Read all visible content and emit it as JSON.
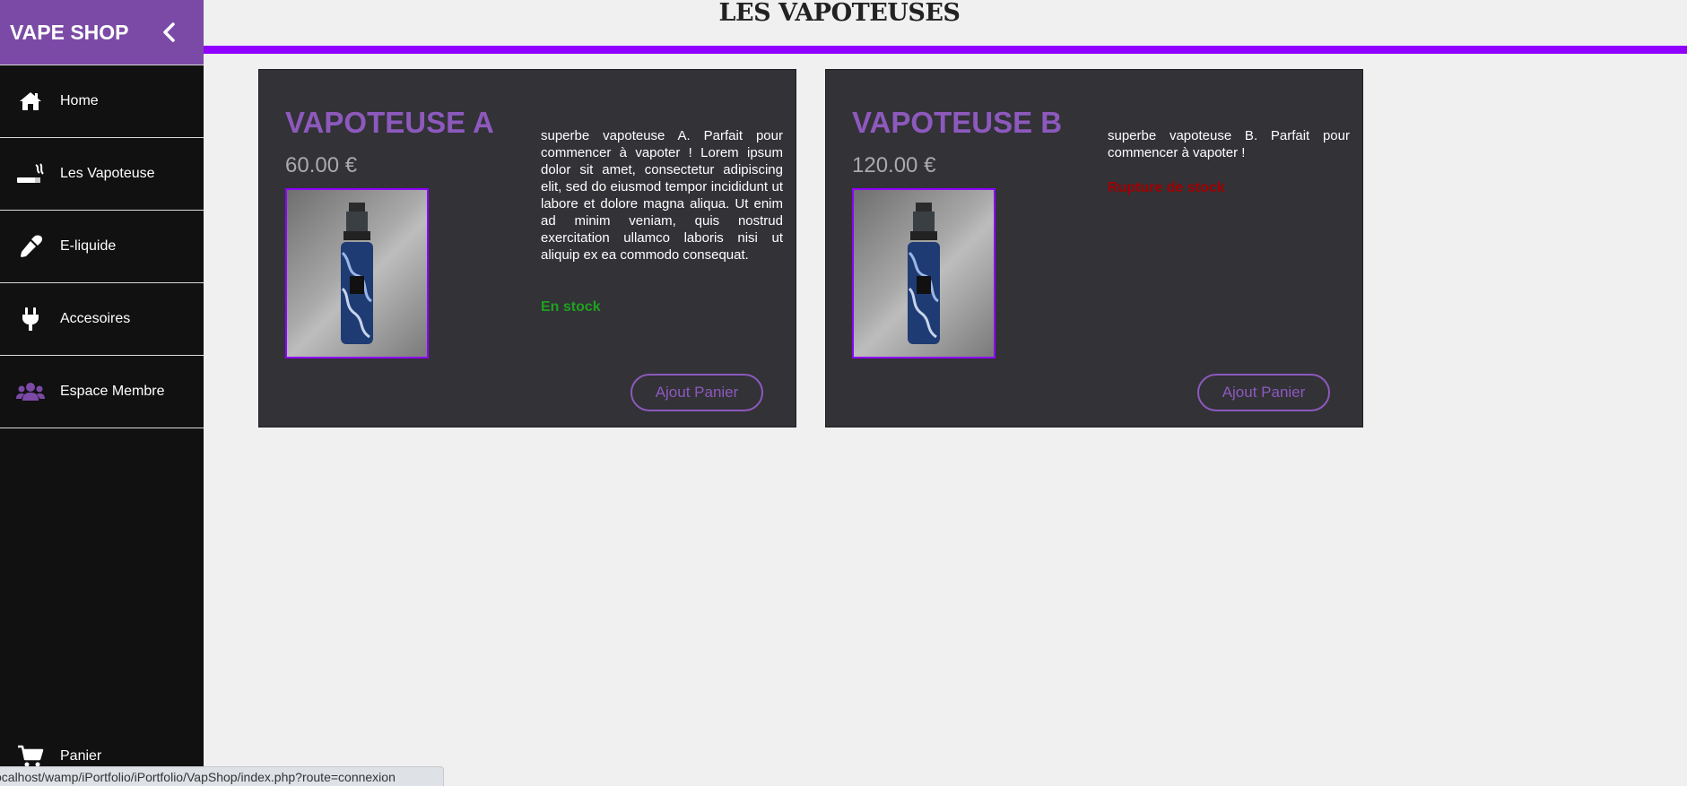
{
  "sidebar": {
    "brand": "VAPE SHOP",
    "items": [
      {
        "label": "Home",
        "icon": "home-icon"
      },
      {
        "label": "Les Vapoteuse",
        "icon": "cigarette-icon"
      },
      {
        "label": "E-liquide",
        "icon": "eyedropper-icon"
      },
      {
        "label": "Accesoires",
        "icon": "plug-icon"
      },
      {
        "label": "Espace Membre",
        "icon": "users-icon",
        "icon_color": "#7b4aa6"
      }
    ],
    "bottom_item": {
      "label": "Panier",
      "icon": "cart-icon"
    }
  },
  "header": {
    "title": "LES VAPOTEUSES",
    "accent_color": "#8f00ff"
  },
  "products": [
    {
      "name": "VAPOTEUSE A",
      "price": "60.00 €",
      "description": "superbe vapoteuse A. Parfait pour commencer à vapoter ! Lorem ipsum dolor sit amet, consectetur adipiscing elit, sed do eiusmod tempor incididunt ut labore et dolore magna aliqua. Ut enim ad minim veniam, quis nostrud exercitation ullamco laboris nisi ut aliquip ex ea commodo consequat.",
      "stock": "En stock",
      "stock_color": "#1fa11f",
      "button": "Ajout Panier"
    },
    {
      "name": "VAPOTEUSE B",
      "price": "120.00 €",
      "description": "superbe vapoteuse B. Parfait pour commencer à vapoter !",
      "stock": "Rupture de stock",
      "stock_color": "#a00000",
      "button": "Ajout Panier"
    }
  ],
  "status_bar": {
    "url": "ocalhost/wamp/iPortfolio/iPortfolio/VapShop/index.php?route=connexion"
  },
  "colors": {
    "brand": "#7b4aa6",
    "sidebar_bg": "#111111",
    "card_bg": "#323237",
    "product_accent": "#8d59bd"
  }
}
